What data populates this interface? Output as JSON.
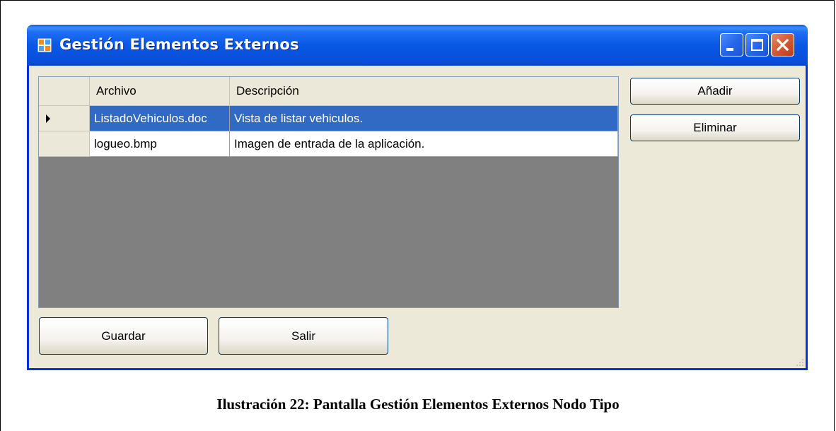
{
  "window": {
    "title": "Gestión Elementos Externos"
  },
  "grid": {
    "columns": [
      "Archivo",
      "Descripción"
    ],
    "rows": [
      {
        "archivo": "ListadoVehiculos.doc",
        "descripcion": "Vista de listar vehiculos.",
        "selected": true
      },
      {
        "archivo": "logueo.bmp",
        "descripcion": "Imagen de entrada de la aplicación.",
        "selected": false
      }
    ]
  },
  "buttons": {
    "add": "Añadir",
    "delete": "Eliminar",
    "save": "Guardar",
    "exit": "Salir"
  },
  "caption": "Ilustración 22: Pantalla Gestión Elementos Externos Nodo Tipo",
  "colors": {
    "titlebar": "#0958e4",
    "selection": "#316ac5",
    "window_bg": "#ece9d8",
    "grid_bg": "#808080"
  }
}
